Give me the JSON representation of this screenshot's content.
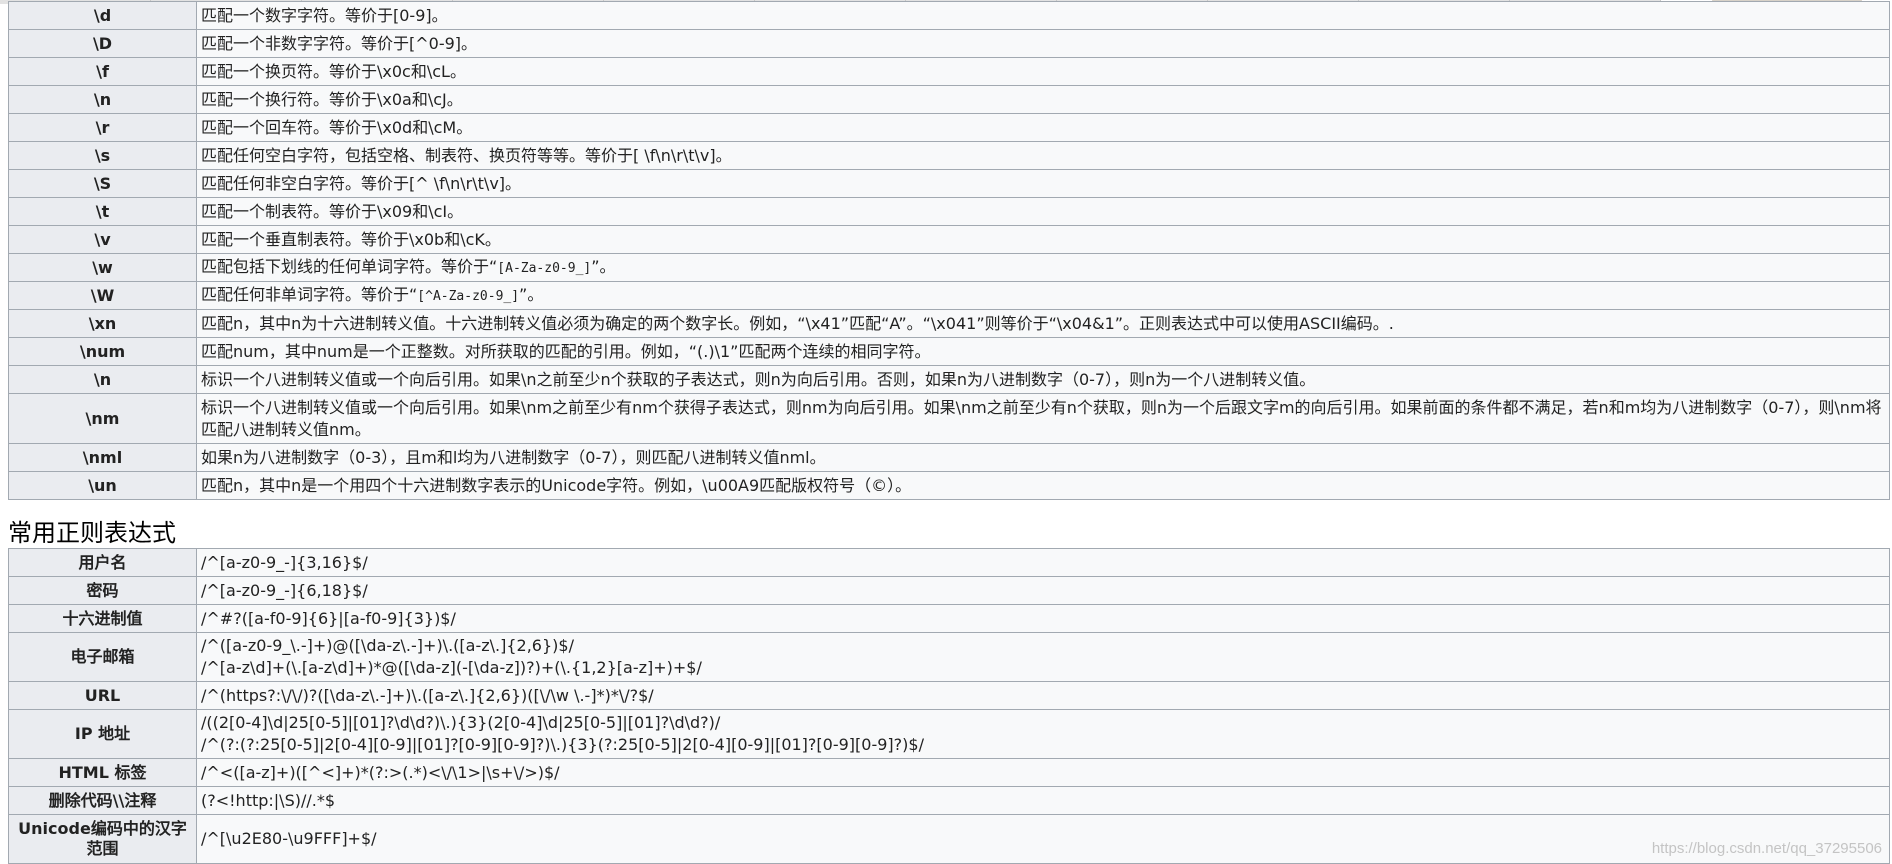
{
  "metachar_table": [
    {
      "key": "\\d",
      "desc": "匹配一个数字字符。等价于[0-9]。"
    },
    {
      "key": "\\D",
      "desc": "匹配一个非数字字符。等价于[^0-9]。"
    },
    {
      "key": "\\f",
      "desc": "匹配一个换页符。等价于\\x0c和\\cL。"
    },
    {
      "key": "\\n",
      "desc": "匹配一个换行符。等价于\\x0a和\\cJ。"
    },
    {
      "key": "\\r",
      "desc": "匹配一个回车符。等价于\\x0d和\\cM。"
    },
    {
      "key": "\\s",
      "desc": "匹配任何空白字符，包括空格、制表符、换页符等等。等价于[ \\f\\n\\r\\t\\v]。"
    },
    {
      "key": "\\S",
      "desc": "匹配任何非空白字符。等价于[^ \\f\\n\\r\\t\\v]。"
    },
    {
      "key": "\\t",
      "desc": "匹配一个制表符。等价于\\x09和\\cI。"
    },
    {
      "key": "\\v",
      "desc": "匹配一个垂直制表符。等价于\\x0b和\\cK。"
    },
    {
      "key": "\\w",
      "desc_a": "匹配包括下划线的任何单词字符。等价于“",
      "desc_code": "[A-Za-z0-9_]",
      "desc_b": "”。"
    },
    {
      "key": "\\W",
      "desc_a": "匹配任何非单词字符。等价于“",
      "desc_code": "[^A-Za-z0-9_]",
      "desc_b": "”。"
    },
    {
      "key": "\\xn",
      "desc": "匹配n，其中n为十六进制转义值。十六进制转义值必须为确定的两个数字长。例如，“\\x41”匹配“A”。“\\x041”则等价于“\\x04&1”。正则表达式中可以使用ASCII编码。."
    },
    {
      "key": "\\num",
      "desc": "匹配num，其中num是一个正整数。对所获取的匹配的引用。例如，“(.)\\1”匹配两个连续的相同字符。"
    },
    {
      "key": "\\n",
      "desc": "标识一个八进制转义值或一个向后引用。如果\\n之前至少n个获取的子表达式，则n为向后引用。否则，如果n为八进制数字（0-7），则n为一个八进制转义值。"
    },
    {
      "key": "\\nm",
      "desc": "标识一个八进制转义值或一个向后引用。如果\\nm之前至少有nm个获得子表达式，则nm为向后引用。如果\\nm之前至少有n个获取，则n为一个后跟文字m的向后引用。如果前面的条件都不满足，若n和m均为八进制数字（0-7），则\\nm将匹配八进制转义值nm。"
    },
    {
      "key": "\\nml",
      "desc": "如果n为八进制数字（0-3），且m和l均为八进制数字（0-7），则匹配八进制转义值nml。"
    },
    {
      "key": "\\un",
      "desc": "匹配n，其中n是一个用四个十六进制数字表示的Unicode字符。例如，\\u00A9匹配版权符号（©）。"
    }
  ],
  "section_title": "常用正则表达式",
  "common_table": [
    {
      "key": "用户名",
      "lines": [
        "/^[a-z0-9_-]{3,16}$/"
      ]
    },
    {
      "key": "密码",
      "lines": [
        "/^[a-z0-9_-]{6,18}$/"
      ]
    },
    {
      "key": "十六进制值",
      "lines": [
        "/^#?([a-f0-9]{6}|[a-f0-9]{3})$/"
      ]
    },
    {
      "key": "电子邮箱",
      "lines": [
        "/^([a-z0-9_\\.-]+)@([\\da-z\\.-]+)\\.([a-z\\.]{2,6})$/",
        "/^[a-z\\d]+(\\.[a-z\\d]+)*@([\\da-z](-[\\da-z])?)+(\\.{1,2}[a-z]+)+$/"
      ]
    },
    {
      "key": "URL",
      "lines": [
        "/^(https?:\\/\\/)?([\\da-z\\.-]+)\\.([a-z\\.]{2,6})([\\/\\w \\.-]*)*\\/?$/"
      ]
    },
    {
      "key": "IP 地址",
      "lines": [
        "/((2[0-4]\\d|25[0-5]|[01]?\\d\\d?)\\.){3}(2[0-4]\\d|25[0-5]|[01]?\\d\\d?)/",
        "/^(?:(?:25[0-5]|2[0-4][0-9]|[01]?[0-9][0-9]?)\\.){3}(?:25[0-5]|2[0-4][0-9]|[01]?[0-9][0-9]?)$/"
      ]
    },
    {
      "key": "HTML 标签",
      "lines": [
        "/^<([a-z]+)([^<]+)*(?:>(.*)<\\/\\1>|\\s+\\/>)$/"
      ]
    },
    {
      "key": "删除代码\\\\注释",
      "lines": [
        "(?<!http:|\\S)//.*$"
      ]
    },
    {
      "key": "Unicode编码中的汉字范围",
      "lines": [
        "/^[\\u2E80-\\u9FFF]+$/"
      ]
    }
  ],
  "watermark": "https://blog.csdn.net/qq_37295506"
}
